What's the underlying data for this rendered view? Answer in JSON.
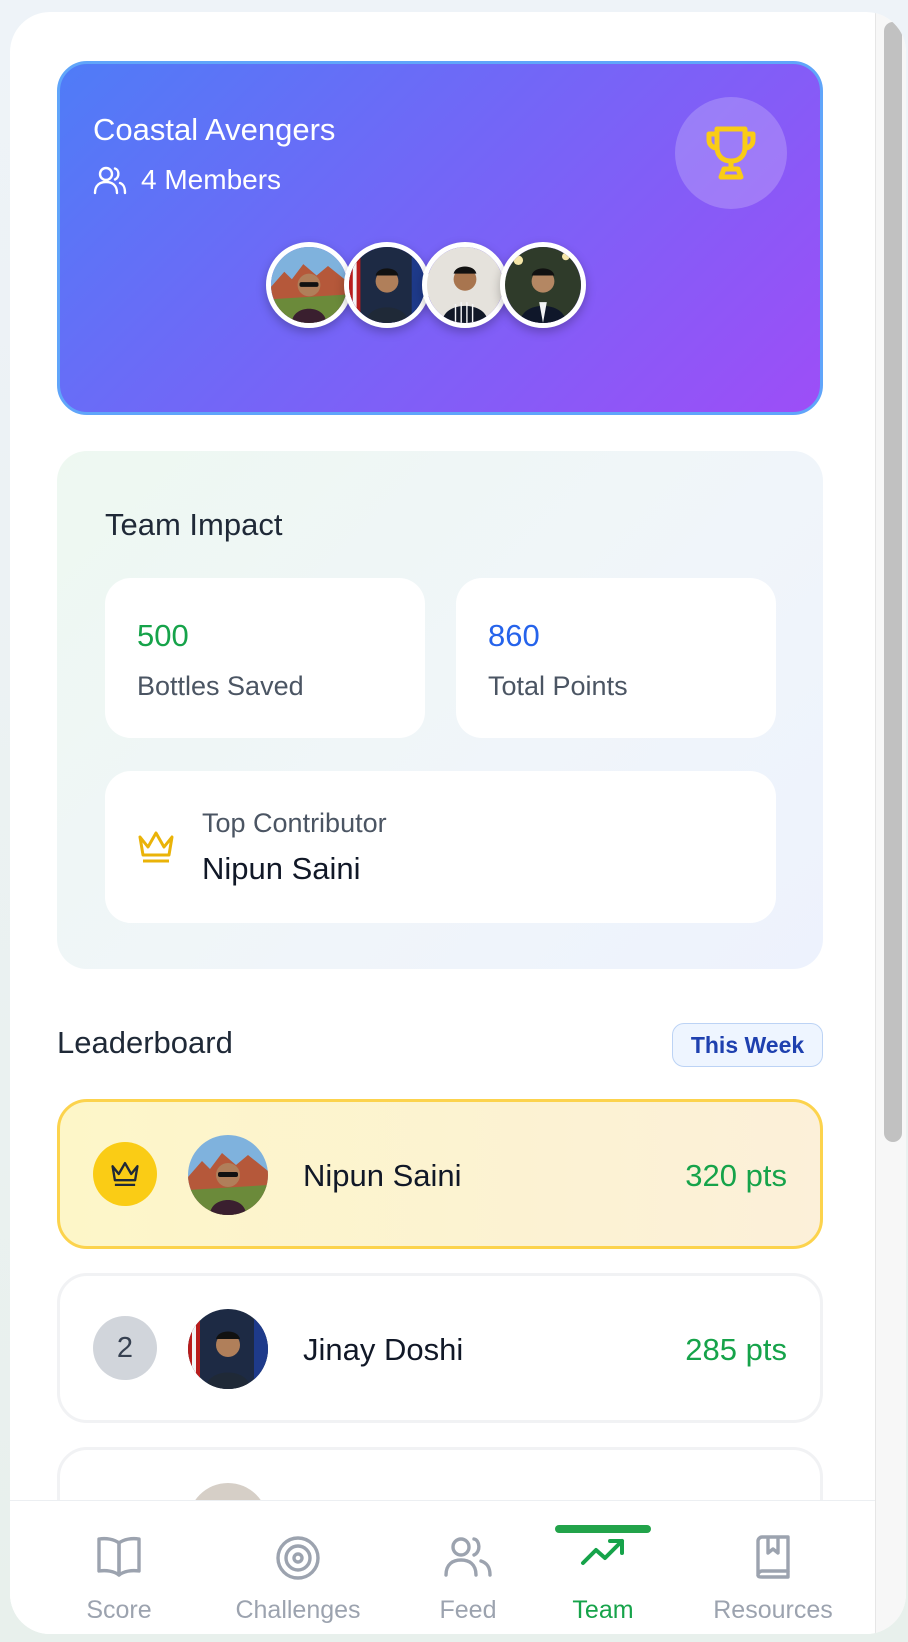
{
  "team": {
    "name": "Coastal Avengers",
    "members_label": "4 Members",
    "avatars": [
      "Nipun Saini",
      "Jinay Doshi",
      "member 3",
      "member 4"
    ]
  },
  "impact": {
    "title": "Team Impact",
    "bottles_value": "500",
    "bottles_label": "Bottles Saved",
    "points_value": "860",
    "points_label": "Total Points",
    "top_label": "Top Contributor",
    "top_name": "Nipun Saini"
  },
  "leaderboard": {
    "title": "Leaderboard",
    "period": "This Week",
    "rows": [
      {
        "rank": "",
        "name": "Nipun Saini",
        "points": "320 pts"
      },
      {
        "rank": "2",
        "name": "Jinay Doshi",
        "points": "285 pts"
      }
    ]
  },
  "nav": {
    "items": [
      {
        "label": "Score",
        "icon": "book-open-icon"
      },
      {
        "label": "Challenges",
        "icon": "target-icon"
      },
      {
        "label": "Feed",
        "icon": "users-icon"
      },
      {
        "label": "Team",
        "icon": "trending-up-icon"
      },
      {
        "label": "Resources",
        "icon": "bookmark-book-icon"
      }
    ],
    "active": "Team"
  },
  "colors": {
    "accent_green": "#16a34a",
    "accent_blue": "#2563eb",
    "gold": "#facc15",
    "team_gradient_start": "#4f7cf7",
    "team_gradient_end": "#9d4ef7"
  }
}
